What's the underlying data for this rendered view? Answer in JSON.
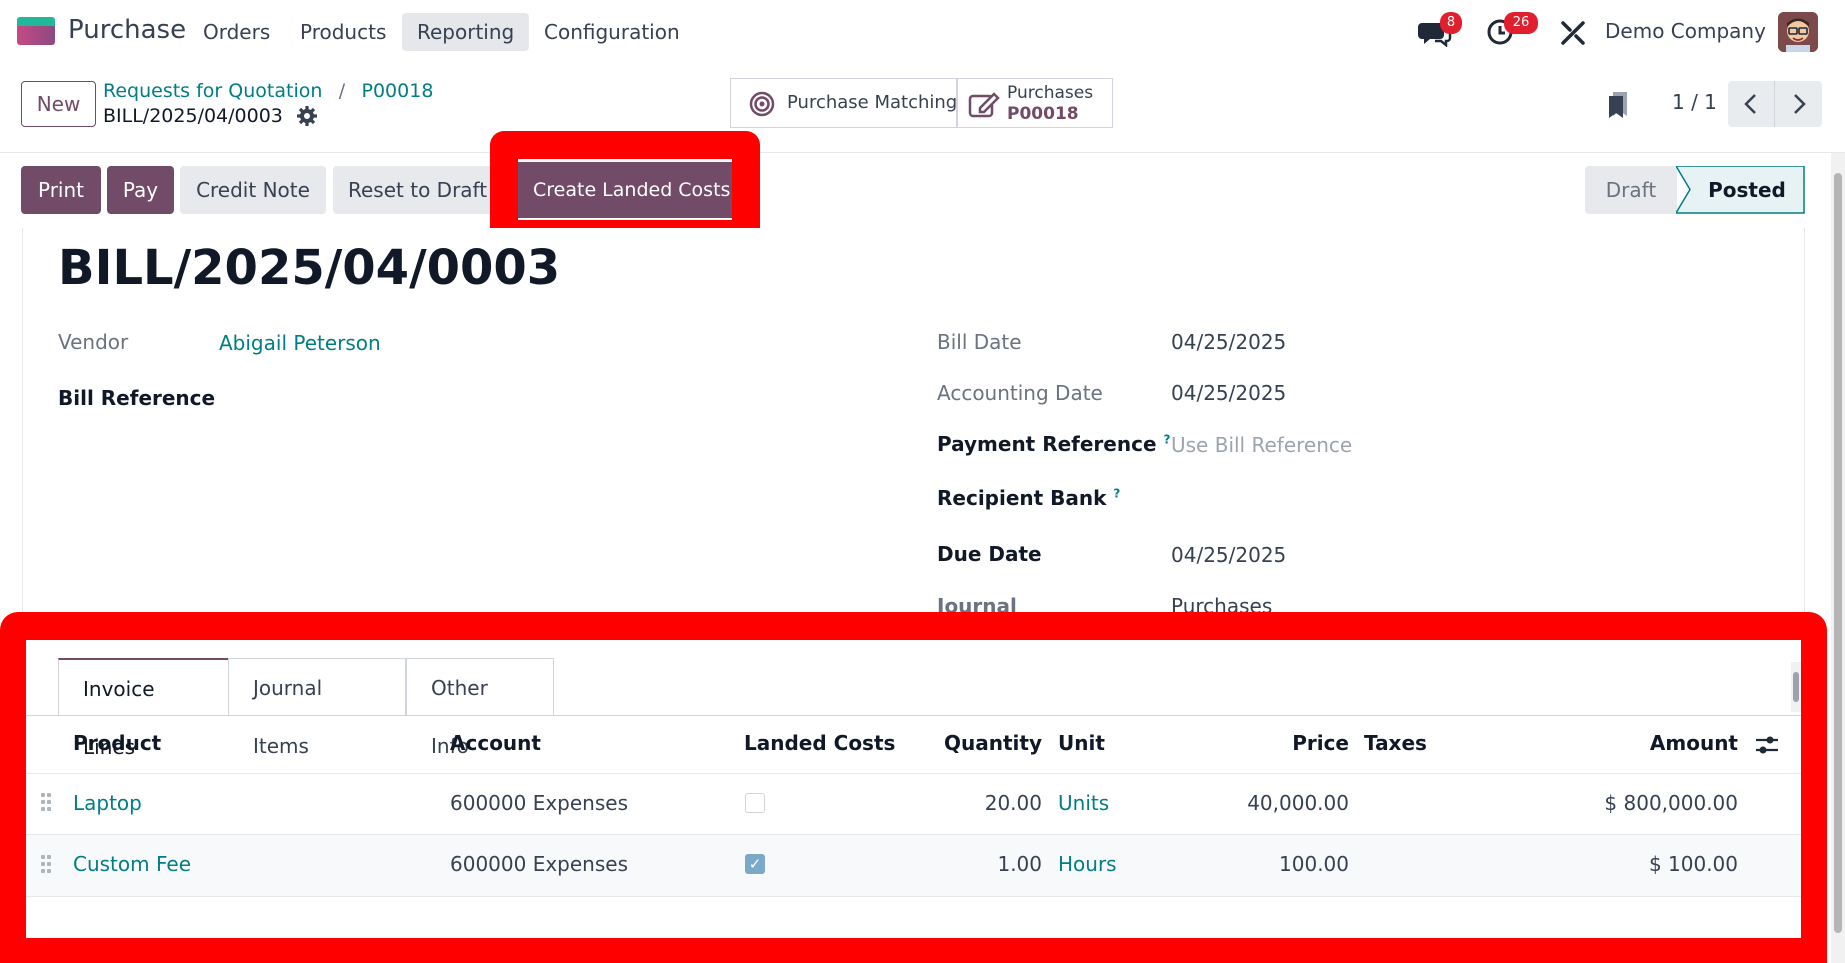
{
  "topnav": {
    "app_name": "Purchase",
    "menu": [
      "Orders",
      "Products",
      "Reporting",
      "Configuration"
    ],
    "active_menu": "Reporting",
    "messages_badge": "8",
    "activities_badge": "26",
    "company": "Demo Company"
  },
  "control": {
    "new_label": "New",
    "breadcrumb_parent": "Requests for Quotation",
    "breadcrumb_sep": "/",
    "breadcrumb_order": "P00018",
    "record_name": "BILL/2025/04/0003",
    "smart_matching": "Purchase Matching",
    "smart_purchases_label": "Purchases",
    "smart_purchases_value": "P00018",
    "pager": "1 / 1"
  },
  "actions": {
    "print": "Print",
    "pay": "Pay",
    "credit_note": "Credit Note",
    "reset": "Reset to Draft",
    "landed_costs": "Create Landed Costs"
  },
  "status": {
    "draft": "Draft",
    "posted": "Posted",
    "current": "Posted"
  },
  "form": {
    "title": "BILL/2025/04/0003",
    "vendor_label": "Vendor",
    "vendor": "Abigail Peterson",
    "bill_ref_label": "Bill Reference",
    "bill_date_label": "Bill Date",
    "bill_date": "04/25/2025",
    "acc_date_label": "Accounting Date",
    "acc_date": "04/25/2025",
    "pay_ref_label": "Payment Reference",
    "pay_ref_placeholder": "Use Bill Reference",
    "bank_label": "Recipient Bank",
    "due_label": "Due Date",
    "due_date": "04/25/2025",
    "journal_label": "Journal",
    "journal": "Purchases",
    "help_mark": "?"
  },
  "tabs": [
    "Invoice Lines",
    "Journal Items",
    "Other Info"
  ],
  "lines": {
    "headers": {
      "product": "Product",
      "account": "Account",
      "landed": "Landed Costs",
      "quantity": "Quantity",
      "unit": "Unit",
      "price": "Price",
      "taxes": "Taxes",
      "amount": "Amount"
    },
    "rows": [
      {
        "product": "Laptop",
        "account": "600000 Expenses",
        "landed": false,
        "quantity": "20.00",
        "unit": "Units",
        "price": "40,000.00",
        "amount": "$ 800,000.00"
      },
      {
        "product": "Custom Fee",
        "account": "600000 Expenses",
        "landed": true,
        "quantity": "1.00",
        "unit": "Hours",
        "price": "100.00",
        "amount": "$ 100.00"
      }
    ]
  },
  "colors": {
    "primary": "#714b67",
    "link": "#017e84",
    "highlight": "#ff0000",
    "badge": "#e0202e"
  }
}
